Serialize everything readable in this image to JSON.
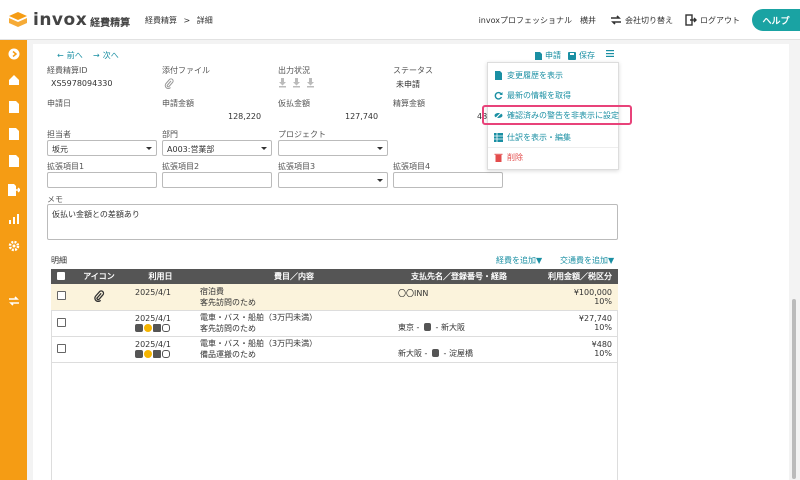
{
  "app": {
    "logo_text": "invox",
    "logo_sub": "経費精算"
  },
  "breadcrumb": {
    "item1": "経費精算",
    "sep": ">",
    "item2": "詳細"
  },
  "topright": {
    "user": "invoxプロフェッショナル　横井",
    "switch_company": "会社切り替え",
    "logout": "ログアウト",
    "help": "ヘルプ"
  },
  "nav": {
    "prev": "前へ",
    "next": "次へ",
    "apply": "申請",
    "save": "保存"
  },
  "fields": {
    "expense_id_label": "経費精算ID",
    "expense_id_value": "XS5978094330",
    "attachment_label": "添付ファイル",
    "output_status_label": "出力状況",
    "status_label": "ステータス",
    "status_value": "未申請",
    "date_label": "申請日",
    "amount_label": "申請金額",
    "amount_value": "128,220",
    "advance_label": "仮払金額",
    "advance_value": "127,740",
    "settle_label": "精算金額",
    "settle_value_partial": "48",
    "assignee_label": "担当者",
    "assignee_value": "坂元",
    "dept_label": "部門",
    "dept_value": "A003:営業部",
    "project_label": "プロジェクト",
    "project_value": "",
    "ext1": "拡張項目1",
    "ext2": "拡張項目2",
    "ext3": "拡張項目3",
    "ext4": "拡張項目4",
    "memo_label": "メモ",
    "memo_value": "仮払い金額との差額あり"
  },
  "menu": {
    "items": [
      {
        "label": "変更履歴を表示"
      },
      {
        "label": "最新の情報を取得"
      },
      {
        "label": "確認済みの警告を非表示に設定"
      },
      {
        "label": "仕訳を表示・編集"
      },
      {
        "label": "削除"
      }
    ]
  },
  "detail": {
    "title": "明細",
    "add_expense": "経費を追加▼",
    "add_transport": "交通費を追加▼",
    "columns": [
      "アイコン",
      "利用日",
      "費目／内容",
      "支払先名／登録番号・経路",
      "利用金額／税区分"
    ],
    "rows": [
      {
        "date": "2025/4/1",
        "category": "宿泊費",
        "content": "客先訪問のため",
        "payee": "〇〇INN",
        "amount": "¥100,000",
        "tax": "10%"
      },
      {
        "date": "2025/4/1",
        "category": "電車・バス・船舶（3万円未満）",
        "content": "客先訪問のため",
        "route_from": "東京",
        "route_to": "新大阪",
        "amount": "¥27,740",
        "tax": "10%"
      },
      {
        "date": "2025/4/1",
        "category": "電車・バス・船舶（3万円未満）",
        "content": "備品運搬のため",
        "route_from": "新大阪",
        "route_to": "淀屋橋",
        "amount": "¥480",
        "tax": "10%"
      }
    ]
  },
  "colors": {
    "accent_orange": "#f59c14",
    "teal": "#1aa3a3",
    "link": "#1a8fa3",
    "highlight_pink": "#e8437a"
  }
}
